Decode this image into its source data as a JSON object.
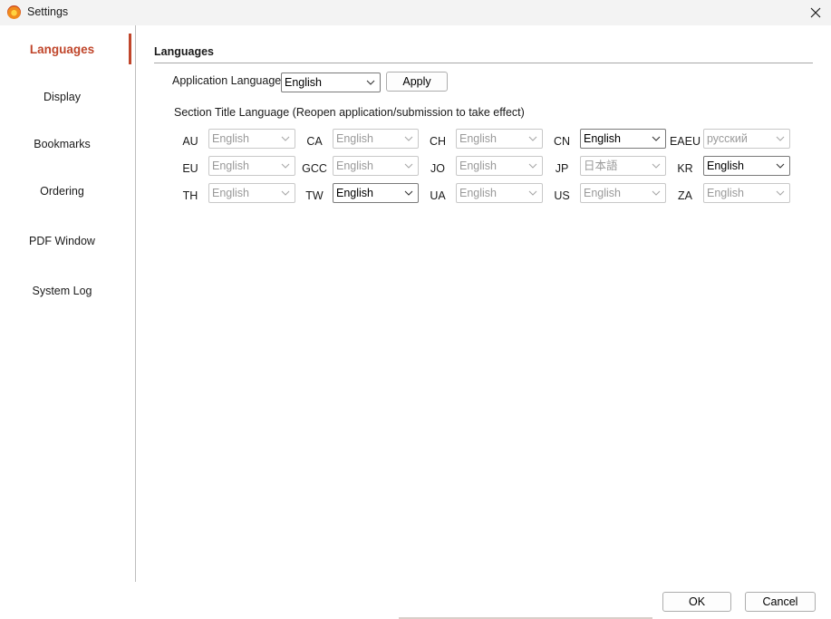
{
  "window": {
    "title": "Settings"
  },
  "sidebar": {
    "items": [
      {
        "label": "Languages",
        "active": true
      },
      {
        "label": "Display"
      },
      {
        "label": "Bookmarks"
      },
      {
        "label": "Ordering"
      },
      {
        "label": "PDF Window"
      },
      {
        "label": "System Log"
      }
    ]
  },
  "languages": {
    "header": "Languages",
    "app_language_label": "Application Language",
    "app_language_value": "English",
    "apply_label": "Apply",
    "section_title_label": "Section Title Language (Reopen application/submission to take effect)",
    "regions": [
      {
        "code": "AU",
        "value": "English",
        "enabled": false
      },
      {
        "code": "CA",
        "value": "English",
        "enabled": false
      },
      {
        "code": "CH",
        "value": "English",
        "enabled": false
      },
      {
        "code": "CN",
        "value": "English",
        "enabled": true
      },
      {
        "code": "EAEU",
        "value": "русский",
        "enabled": false
      },
      {
        "code": "EU",
        "value": "English",
        "enabled": false
      },
      {
        "code": "GCC",
        "value": "English",
        "enabled": false
      },
      {
        "code": "JO",
        "value": "English",
        "enabled": false
      },
      {
        "code": "JP",
        "value": "日本語",
        "enabled": false
      },
      {
        "code": "KR",
        "value": "English",
        "enabled": true
      },
      {
        "code": "TH",
        "value": "English",
        "enabled": false
      },
      {
        "code": "TW",
        "value": "English",
        "enabled": true
      },
      {
        "code": "UA",
        "value": "English",
        "enabled": false
      },
      {
        "code": "US",
        "value": "English",
        "enabled": false
      },
      {
        "code": "ZA",
        "value": "English",
        "enabled": false
      }
    ]
  },
  "footer": {
    "ok_label": "OK",
    "cancel_label": "Cancel"
  },
  "colors": {
    "accent": "#c0462b",
    "disabled_text": "#9a9a9a"
  }
}
